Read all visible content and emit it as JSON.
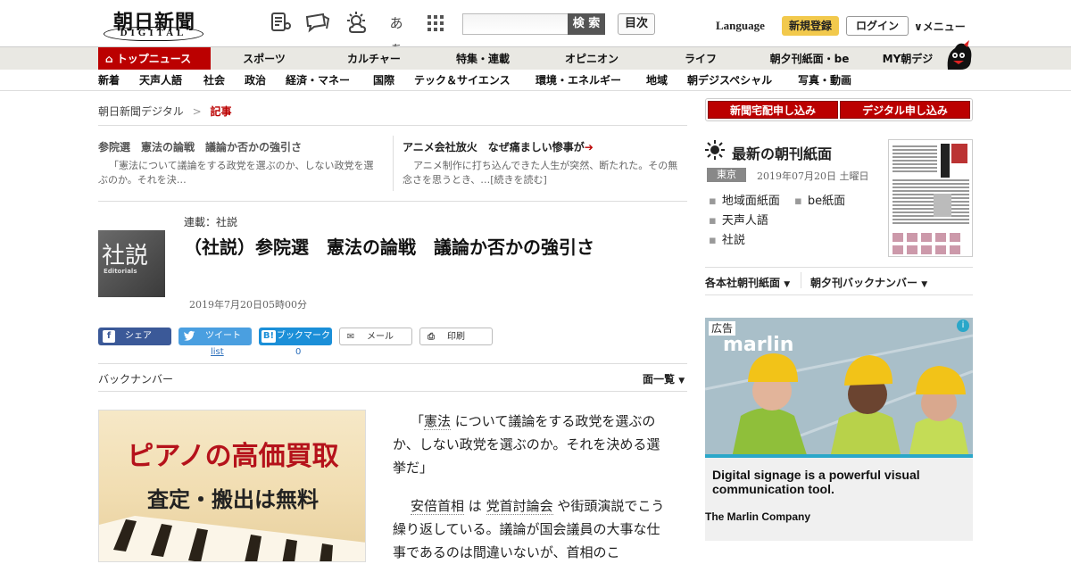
{
  "header": {
    "logo_main": "朝日新聞",
    "logo_sub": "DIGITAL",
    "icons": [
      "list-icon",
      "chat-icon",
      "weather-icon",
      "font-size-icon",
      "grid-icon"
    ],
    "font_size_label": "あぁ",
    "search_placeholder": "",
    "search_button": "検 索",
    "contents_button": "目次",
    "language": "Language",
    "register": "新規登録",
    "login": "ログイン",
    "menu": "メニュー"
  },
  "nav_main": {
    "top_news": "トップニュース",
    "items": [
      "スポーツ",
      "カルチャー",
      "特集・連載",
      "オピニオン",
      "ライフ",
      "朝夕刊紙面・be",
      "MY朝デジ"
    ]
  },
  "nav_sub": {
    "items": [
      "新着",
      "天声人語",
      "社会",
      "政治",
      "経済・マネー",
      "国際",
      "テック＆サイエンス",
      "環境・エネルギー",
      "地域",
      "朝デジスペシャル",
      "写真・動画"
    ]
  },
  "breadcrumb": {
    "home": "朝日新聞デジタル",
    "separator": ">",
    "current": "記事"
  },
  "related": [
    {
      "title": "参院選　憲法の論戦　議論か否かの強引さ",
      "text": "「憲法について議論をする政党を選ぶのか、しない政党を選ぶのか。それを決…"
    },
    {
      "title": "アニメ会社放火　なぜ痛ましい惨事が",
      "text": "アニメ制作に打ち込んできた人生が突然、断たれた。その無念さを思うとき、…[続きを読む]"
    }
  ],
  "article": {
    "thumb_main": "社説",
    "thumb_sub": "Editorials",
    "series": "連載：社説",
    "title": "（社説）参院選　憲法の論戦　議論か否かの強引さ",
    "date": "2019年7月20日05時00分",
    "share": {
      "facebook": "シェア",
      "twitter": "ツイート",
      "twitter_count": "list",
      "hatena": "ブックマーク",
      "hatena_count": "0",
      "mail": "メール",
      "print": "印刷"
    },
    "backnumber": "バックナンバー",
    "all_pages": "面一覧",
    "paragraph1": [
      "「",
      "憲法",
      " について議論をする政党を選ぶのか、しない政党を選ぶのか。それを決める選挙だ」"
    ],
    "paragraph2": [
      "",
      "安倍首相",
      " は ",
      "党首討論会",
      " や街頭演説でこう繰り返している。議論が国会議員の大事な仕事であるのは間違いないが、首相のこ"
    ]
  },
  "piano_ad": {
    "headline": "ピアノの高価買取",
    "sub": "査定・搬出は無料"
  },
  "sidebar": {
    "subscribe_paper": "新聞宅配申し込み",
    "subscribe_digital": "デジタル申し込み",
    "latest_title": "最新の朝刊紙面",
    "region": "東京",
    "paper_date": "2019年07月20日 土曜日",
    "links": [
      "地域面紙面",
      "be紙面",
      "天声人語",
      "社説"
    ],
    "select_1": "各本社朝刊紙面",
    "select_2": "朝夕刊バックナンバー",
    "ad": {
      "tag": "広告",
      "logo": "marlin",
      "headline": "Digital signage is a powerful visual communication tool.",
      "company": "The Marlin Company"
    }
  }
}
